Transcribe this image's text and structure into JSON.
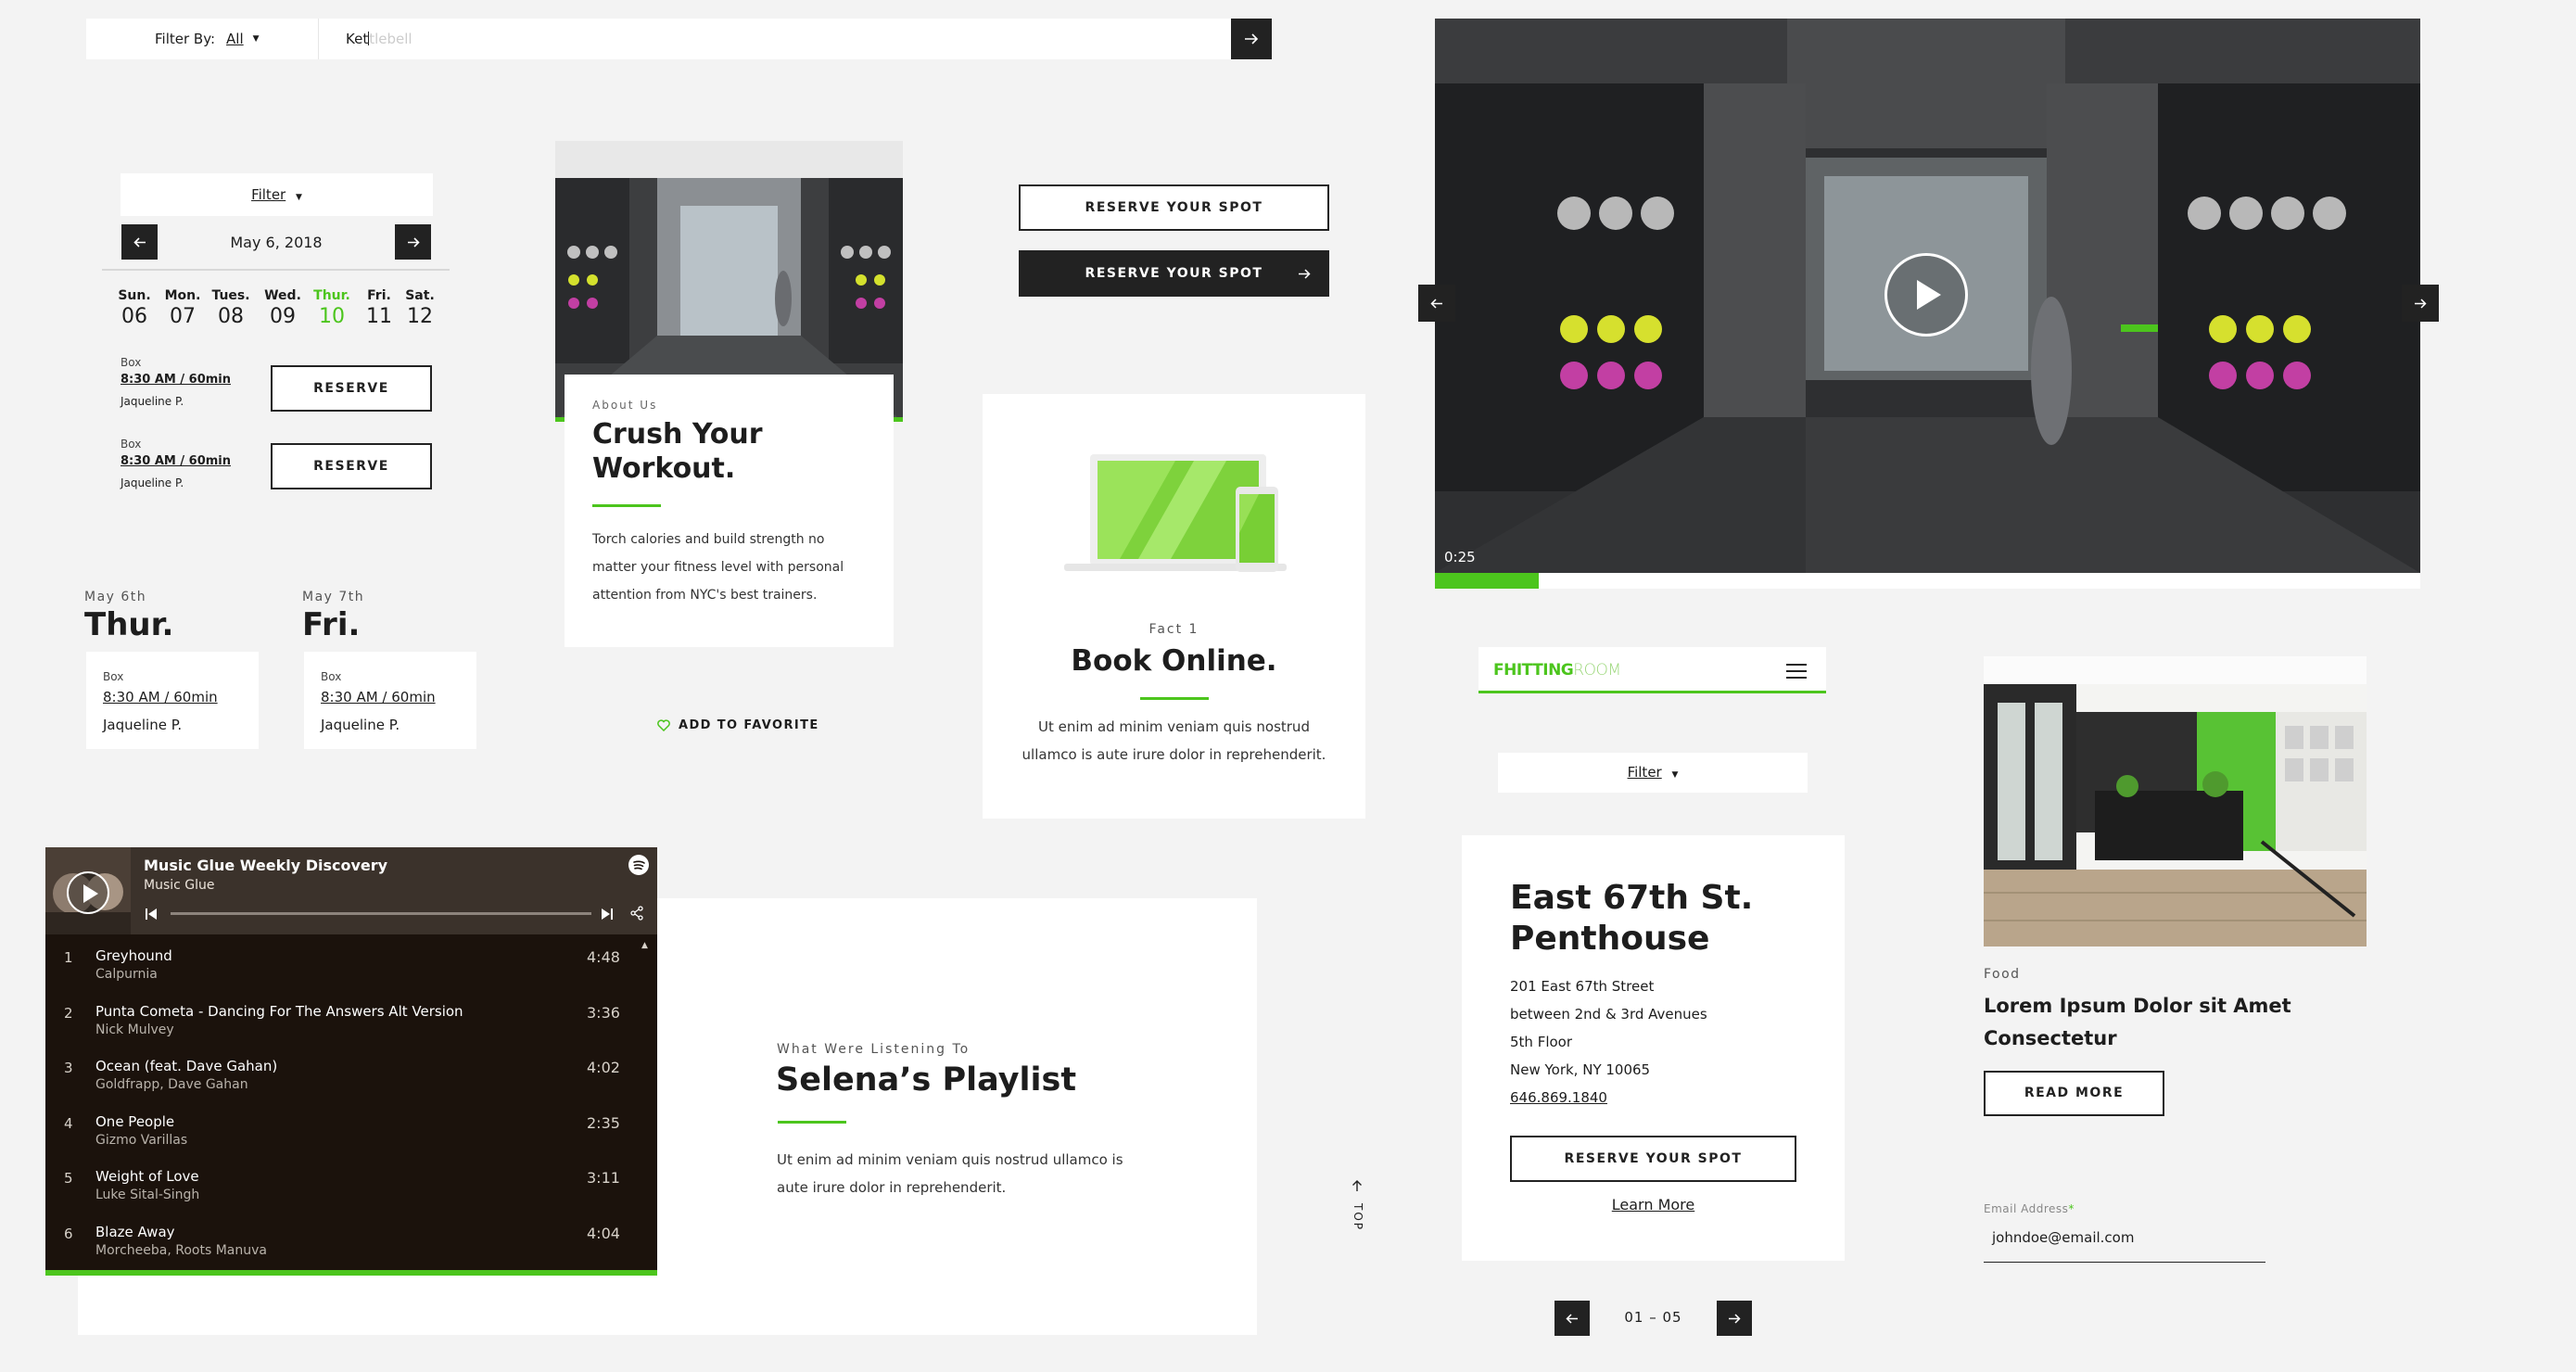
{
  "search": {
    "filter_label": "Filter By:",
    "filter_value": "All",
    "query_typed": "Ket",
    "query_hint": "tlebell"
  },
  "schedule": {
    "filter_label": "Filter",
    "date": "May 6, 2018",
    "days": [
      {
        "name": "Sun.",
        "num": "06"
      },
      {
        "name": "Mon.",
        "num": "07"
      },
      {
        "name": "Tues.",
        "num": "08"
      },
      {
        "name": "Wed.",
        "num": "09"
      },
      {
        "name": "Thur.",
        "num": "10"
      },
      {
        "name": "Fri.",
        "num": "11"
      },
      {
        "name": "Sat.",
        "num": "12"
      }
    ],
    "classes": [
      {
        "type": "Box",
        "time": "8:30 AM / 60min",
        "trainer": "Jaqueline P.",
        "button": "RESERVE"
      },
      {
        "type": "Box",
        "time": "8:30 AM / 60min",
        "trainer": "Jaqueline P.",
        "button": "RESERVE"
      }
    ]
  },
  "day_columns": [
    {
      "date": "May 6th",
      "day": "Thur.",
      "type": "Box",
      "time": "8:30 AM / 60min",
      "trainer": "Jaqueline P."
    },
    {
      "date": "May 7th",
      "day": "Fri.",
      "type": "Box",
      "time": "8:30 AM / 60min",
      "trainer": "Jaqueline P."
    }
  ],
  "about": {
    "eyebrow": "About Us",
    "title_line1": "Crush Your",
    "title_line2": "Workout.",
    "body_line1": "Torch calories and build strength no",
    "body_line2": "matter your fitness level with personal",
    "body_line3": "attention from NYC's best trainers.",
    "favorite": "ADD TO FAVORITE"
  },
  "reserve_buttons": {
    "outline": "RESERVE YOUR SPOT",
    "dark": "RESERVE YOUR SPOT"
  },
  "fact": {
    "eyebrow": "Fact 1",
    "title": "Book Online.",
    "body_line1": "Ut enim ad minim veniam quis nostrud",
    "body_line2": "ullamco is aute irure dolor in reprehenderit."
  },
  "video": {
    "time": "0:25",
    "progress": 0.105
  },
  "playlist": {
    "title": "Music Glue Weekly Discovery",
    "subtitle": "Music Glue",
    "tracks": [
      {
        "num": "1",
        "name": "Greyhound",
        "artist": "Calpurnia",
        "duration": "4:48"
      },
      {
        "num": "2",
        "name": "Punta Cometa - Dancing For The Answers Alt Version",
        "artist": "Nick Mulvey",
        "duration": "3:36"
      },
      {
        "num": "3",
        "name": "Ocean (feat. Dave Gahan)",
        "artist": "Goldfrapp, Dave Gahan",
        "duration": "4:02"
      },
      {
        "num": "4",
        "name": "One People",
        "artist": "Gizmo Varillas",
        "duration": "2:35"
      },
      {
        "num": "5",
        "name": "Weight of Love",
        "artist": "Luke Sital-Singh",
        "duration": "3:11"
      },
      {
        "num": "6",
        "name": "Blaze Away",
        "artist": "Morcheeba, Roots Manuva",
        "duration": "4:04"
      }
    ]
  },
  "listening": {
    "eyebrow": "What Were Listening To",
    "title": "Selena’s Playlist",
    "body_line1": "Ut enim ad minim veniam quis nostrud ullamco is",
    "body_line2": "aute irure dolor in reprehenderit.",
    "top_label": "TOP"
  },
  "mobile": {
    "logo_bold": "FHITTING",
    "logo_light": "ROOM",
    "filter_label": "Filter"
  },
  "location": {
    "title_line1": "East 67th St.",
    "title_line2": "Penthouse",
    "address_line1": "201 East 67th Street",
    "address_line2": "between 2nd & 3rd Avenues",
    "address_line3": "5th Floor",
    "address_line4": "New York, NY 10065",
    "phone": "646.869.1840",
    "button": "RESERVE YOUR SPOT",
    "learn_more": "Learn More"
  },
  "pager": {
    "label": "01 – 05"
  },
  "article": {
    "category": "Food",
    "title_line1": "Lorem Ipsum Dolor sit Amet",
    "title_line2": "Consectetur",
    "button": "READ MORE"
  },
  "email": {
    "label": "Email Address",
    "required": "*",
    "value": "johndoe@email.com"
  },
  "colors": {
    "accent": "#4cc51d",
    "dark": "#222222",
    "background": "#f3f3f3"
  }
}
